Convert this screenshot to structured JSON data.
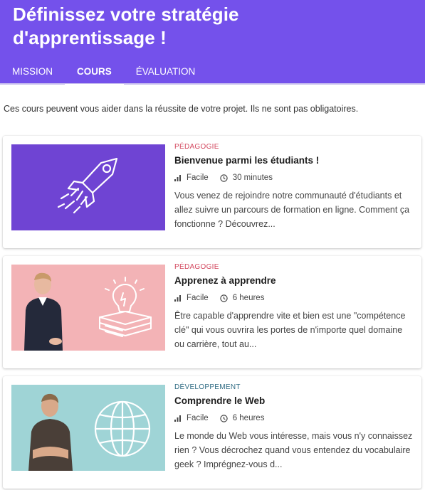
{
  "header": {
    "title": "Définissez votre stratégie d'apprentissage !",
    "background": "#7451eb",
    "tabs": [
      {
        "label": "MISSION"
      },
      {
        "label": "COURS",
        "active": true
      },
      {
        "label": "ÉVALUATION"
      }
    ]
  },
  "intro": "Ces cours peuvent vous aider dans la réussite de votre projet. Ils ne sont pas obligatoires.",
  "courses": [
    {
      "category": "PÉDAGOGIE",
      "title": "Bienvenue parmi les étudiants !",
      "difficulty": "Facile",
      "duration": "30 minutes",
      "description": "Vous venez de rejoindre notre communauté d'étudiants et allez suivre un parcours de formation en ligne. Comment ça fonctionne ? Découvrez...",
      "thumbnail_bg": "#6f44d3",
      "thumbnail_icon": "rocket-icon"
    },
    {
      "category": "PÉDAGOGIE",
      "title": "Apprenez à apprendre",
      "difficulty": "Facile",
      "duration": "6 heures",
      "description": "Être capable d'apprendre vite et bien est une \"compétence clé\" qui vous ouvrira les portes de n'importe quel domaine ou carrière, tout au...",
      "thumbnail_bg": "#f3b3b6",
      "thumbnail_icon": "lightbulb-books-icon"
    },
    {
      "category": "DÉVELOPPEMENT",
      "title": "Comprendre le Web",
      "difficulty": "Facile",
      "duration": "6 heures",
      "description": "Le monde du Web vous intéresse, mais vous n'y connaissez rien ? Vous décrochez quand vous entendez du vocabulaire geek ? Imprégnez-vous d...",
      "thumbnail_bg": "#9fd4d6",
      "thumbnail_icon": "globe-icon"
    }
  ]
}
